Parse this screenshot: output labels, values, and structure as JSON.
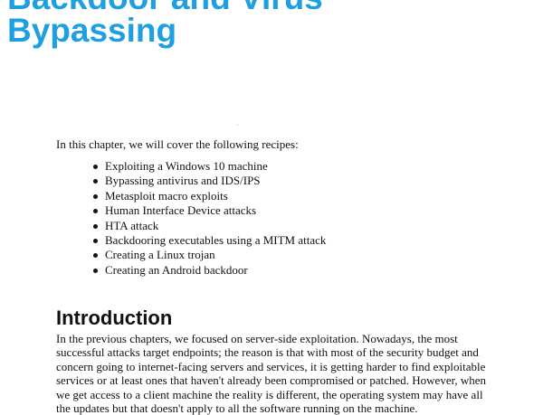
{
  "chapter_title": {
    "line1": "Backdoor and Virus",
    "line2": "Bypassing"
  },
  "intro_sentence": "In this chapter, we will cover the following recipes:",
  "recipes": [
    "Exploiting a Windows 10 machine",
    "Bypassing antivirus and IDS/IPS",
    "Metasploit macro exploits",
    "Human Interface Device attacks",
    "HTA attack",
    "Backdooring executables using a MITM attack",
    "Creating a Linux trojan",
    "Creating an Android backdoor"
  ],
  "section": {
    "heading": "Introduction",
    "lines": [
      "In the previous chapters, we focused on server-side exploitation. Nowadays, the most",
      "successful attacks target endpoints; the reason is that with most of the security budget and",
      "concern going to internet-facing servers and services, it is getting harder to find exploitable",
      "services or at least ones that haven't already been compromised or patched. However, when",
      "we get access to a client machine the reality is different, the operating system may have all",
      "the updates but that doesn't apply to all the software running on the machine."
    ]
  },
  "colors": {
    "title": "#1e9fe0",
    "text": "#111111"
  }
}
